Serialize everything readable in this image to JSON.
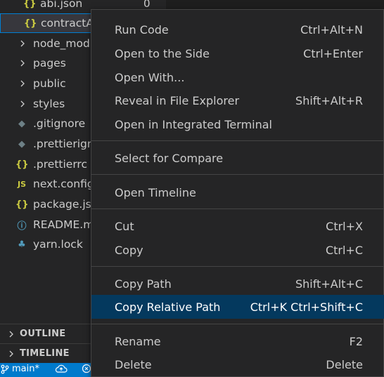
{
  "explorer": {
    "top_items": [
      {
        "name": "abi.json",
        "icon": "{}",
        "count": "0"
      },
      {
        "name": "contractA",
        "icon": "{}"
      }
    ],
    "folders": [
      "node_modu",
      "pages",
      "public",
      "styles"
    ],
    "files": [
      {
        "name": ".gitignore",
        "icon": "git-icon"
      },
      {
        "name": ".prettierign",
        "icon": "git-icon"
      },
      {
        "name": ".prettierrc",
        "icon": "{}"
      },
      {
        "name": "next.config",
        "icon": "JS"
      },
      {
        "name": "package.jso",
        "icon": "{}"
      },
      {
        "name": "README.m",
        "icon": "info-icon"
      },
      {
        "name": "yarn.lock",
        "icon": "yarn-icon"
      }
    ],
    "sections": [
      "OUTLINE",
      "TIMELINE"
    ]
  },
  "statusbar": {
    "branch": "main*"
  },
  "context_menu": {
    "groups": [
      [
        {
          "label": "Run Code",
          "shortcut": "Ctrl+Alt+N"
        },
        {
          "label": "Open to the Side",
          "shortcut": "Ctrl+Enter"
        },
        {
          "label": "Open With...",
          "shortcut": ""
        },
        {
          "label": "Reveal in File Explorer",
          "shortcut": "Shift+Alt+R"
        },
        {
          "label": "Open in Integrated Terminal",
          "shortcut": ""
        }
      ],
      [
        {
          "label": "Select for Compare",
          "shortcut": ""
        }
      ],
      [
        {
          "label": "Open Timeline",
          "shortcut": ""
        }
      ],
      [
        {
          "label": "Cut",
          "shortcut": "Ctrl+X"
        },
        {
          "label": "Copy",
          "shortcut": "Ctrl+C"
        }
      ],
      [
        {
          "label": "Copy Path",
          "shortcut": "Shift+Alt+C"
        },
        {
          "label": "Copy Relative Path",
          "shortcut": "Ctrl+K Ctrl+Shift+C",
          "active": true
        }
      ],
      [
        {
          "label": "Rename",
          "shortcut": "F2"
        },
        {
          "label": "Delete",
          "shortcut": "Delete"
        }
      ]
    ]
  },
  "colors": {
    "menu_highlight": "#04395e",
    "statusbar": "#007acc",
    "json_icon": "#cbcb41"
  }
}
